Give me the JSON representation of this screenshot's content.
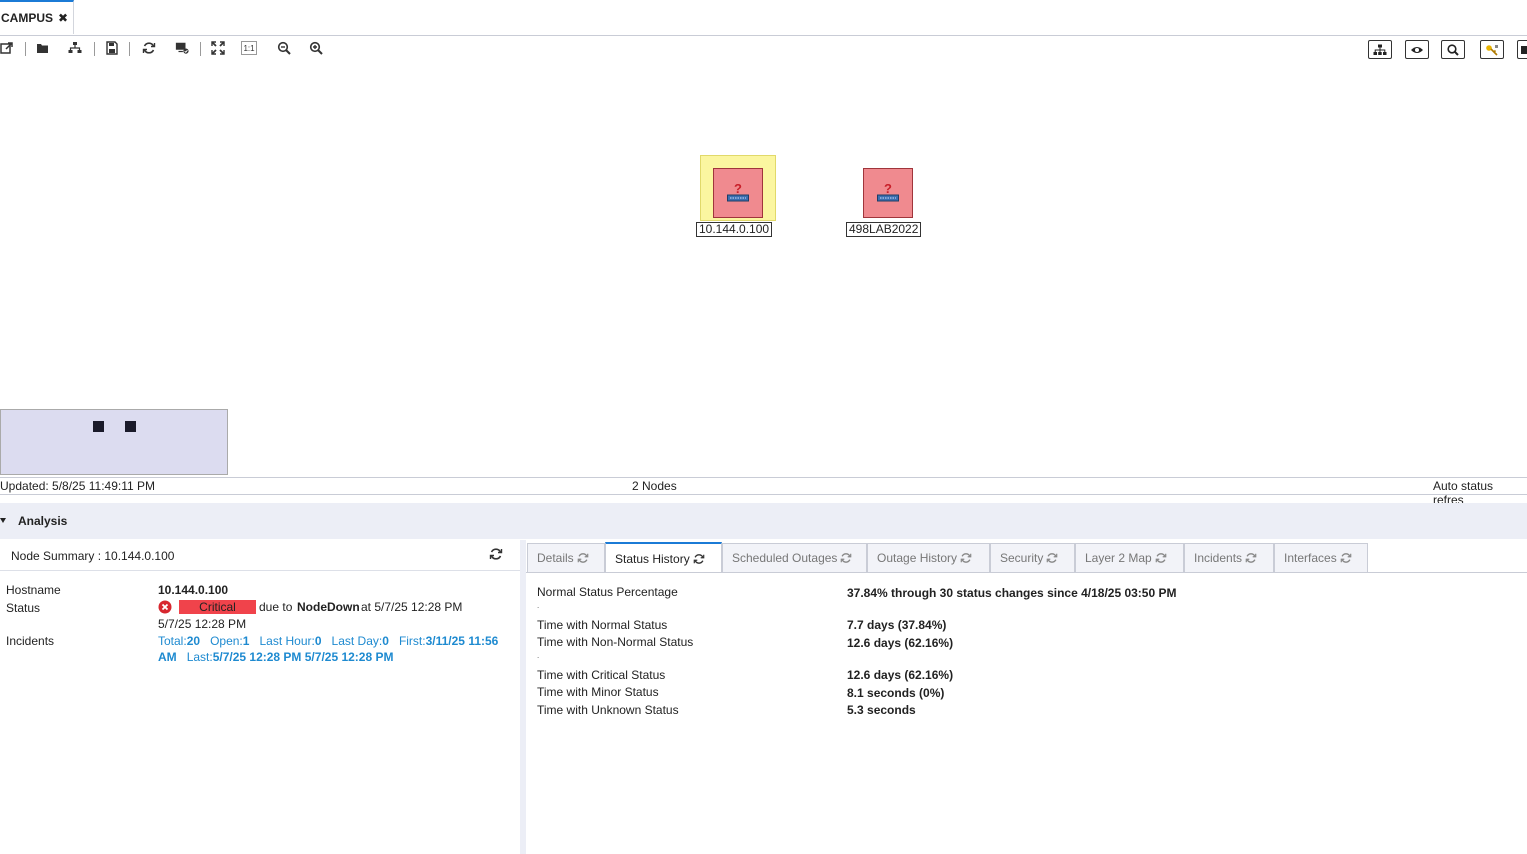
{
  "tab": {
    "title": "CAMPUS",
    "close": "✖"
  },
  "toolbar": {
    "icons": [
      "open-external-icon",
      "folder-open-icon",
      "hierarchy-icon",
      "save-icon",
      "refresh-icon",
      "map-status-icon",
      "fit-to-screen-icon",
      "actual-size-icon",
      "zoom-out-icon",
      "zoom-in-icon"
    ],
    "actual_size_label": "1:1",
    "right_icons": [
      "layout-icon",
      "eye-icon",
      "search-icon",
      "key-icon",
      "panel-icon"
    ]
  },
  "nodes": [
    {
      "label": "10.144.0.100",
      "selected": true,
      "status": "critical",
      "question": "?"
    },
    {
      "label": "498LAB2022",
      "selected": false,
      "status": "critical",
      "question": "?"
    }
  ],
  "statusbar": {
    "updated": "Updated: 5/8/25 11:49:11 PM",
    "nodes_count": "2 Nodes",
    "auto_status": "Auto status refres"
  },
  "analysis": {
    "title": "Analysis",
    "summary_title": "Node Summary : 10.144.0.100",
    "hostname_label": "Hostname",
    "hostname_value": "10.144.0.100",
    "status_label": "Status",
    "status_badge": "Critical",
    "status_due": "due to",
    "status_cause": "NodeDown",
    "status_at": "at 5/7/25 12:28 PM",
    "status_time2": "5/7/25 12:28 PM",
    "incidents_label": "Incidents",
    "incidents": {
      "total_label": "Total:",
      "total": "20",
      "open_label": "Open:",
      "open": "1",
      "last_hour_label": "Last Hour:",
      "last_hour": "0",
      "last_day_label": "Last Day:",
      "last_day": "0",
      "first_label": "First:",
      "first_a": "3/11/25 11:56",
      "first_b": "AM",
      "last_label": "Last:",
      "last": "5/7/25 12:28 PM 5/7/25 12:28 PM"
    },
    "colors": {
      "critical": "#f0434b",
      "link_blue": "#1e8ad0",
      "accent": "#1b7bd6"
    }
  },
  "tabs": [
    {
      "label": "Details",
      "active": false
    },
    {
      "label": "Status History",
      "active": true
    },
    {
      "label": "Scheduled Outages",
      "active": false
    },
    {
      "label": "Outage History",
      "active": false
    },
    {
      "label": "Security",
      "active": false
    },
    {
      "label": "Layer 2 Map",
      "active": false
    },
    {
      "label": "Incidents",
      "active": false
    },
    {
      "label": "Interfaces",
      "active": false
    }
  ],
  "status_history": [
    {
      "label": "Normal Status Percentage",
      "value": "37.84% through 30 status changes since 4/18/25 03:50 PM"
    },
    {
      "label": "Time with Normal Status",
      "value": "7.7 days (37.84%)"
    },
    {
      "label": "Time with Non-Normal Status",
      "value": "12.6 days (62.16%)"
    },
    {
      "label": "Time with Critical Status",
      "value": "12.6 days (62.16%)"
    },
    {
      "label": "Time with Minor Status",
      "value": "8.1 seconds (0%)"
    },
    {
      "label": "Time with Unknown Status",
      "value": "5.3 seconds"
    }
  ]
}
